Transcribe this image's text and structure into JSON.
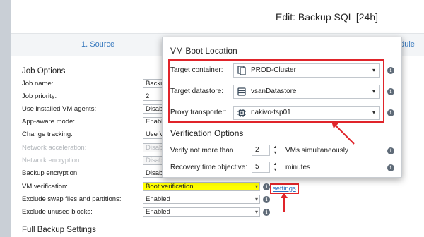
{
  "window": {
    "title": "Edit: Backup SQL [24h]"
  },
  "steps": {
    "source": "1. Source",
    "schedule_partial": "edule"
  },
  "job_options": {
    "title": "Job Options",
    "rows": [
      {
        "label": "Job name:",
        "value": "Backu",
        "disabled": false
      },
      {
        "label": "Job priority:",
        "value": "2",
        "disabled": false
      },
      {
        "label": "Use installed VM agents:",
        "value": "Disab",
        "disabled": false
      },
      {
        "label": "App-aware mode:",
        "value": "Enabl",
        "disabled": false
      },
      {
        "label": "Change tracking:",
        "value": "Use V",
        "disabled": false
      },
      {
        "label": "Network acceleration:",
        "value": "Disab",
        "disabled": true
      },
      {
        "label": "Network encryption:",
        "value": "Disab",
        "disabled": true
      },
      {
        "label": "Backup encryption:",
        "value": "Disab",
        "disabled": false
      }
    ],
    "vm_verification": {
      "label": "VM verification:",
      "value": "Boot verification",
      "settings_link": "settings"
    },
    "exclude_swap": {
      "label": "Exclude swap files and partitions:",
      "value": "Enabled"
    },
    "exclude_unused": {
      "label": "Exclude unused blocks:",
      "value": "Enabled"
    }
  },
  "full_backup": {
    "title": "Full Backup Settings"
  },
  "popup": {
    "title": "VM Boot Location",
    "target_container": {
      "label": "Target container:",
      "value": "PROD-Cluster",
      "icon": "cluster-icon"
    },
    "target_datastore": {
      "label": "Target datastore:",
      "value": "vsanDatastore",
      "icon": "datastore-icon"
    },
    "proxy_transporter": {
      "label": "Proxy transporter:",
      "value": "nakivo-tsp01",
      "icon": "chip-icon"
    },
    "verification_title": "Verification Options",
    "verify_not_more": {
      "label": "Verify not more than",
      "value": "2",
      "unit": "VMs simultaneously"
    },
    "recovery_objective": {
      "label": "Recovery time objective:",
      "value": "5",
      "unit": "minutes"
    }
  },
  "colors": {
    "highlight": "#ffff00",
    "annotation_red": "#e0242a",
    "link": "#2a6fc0"
  }
}
